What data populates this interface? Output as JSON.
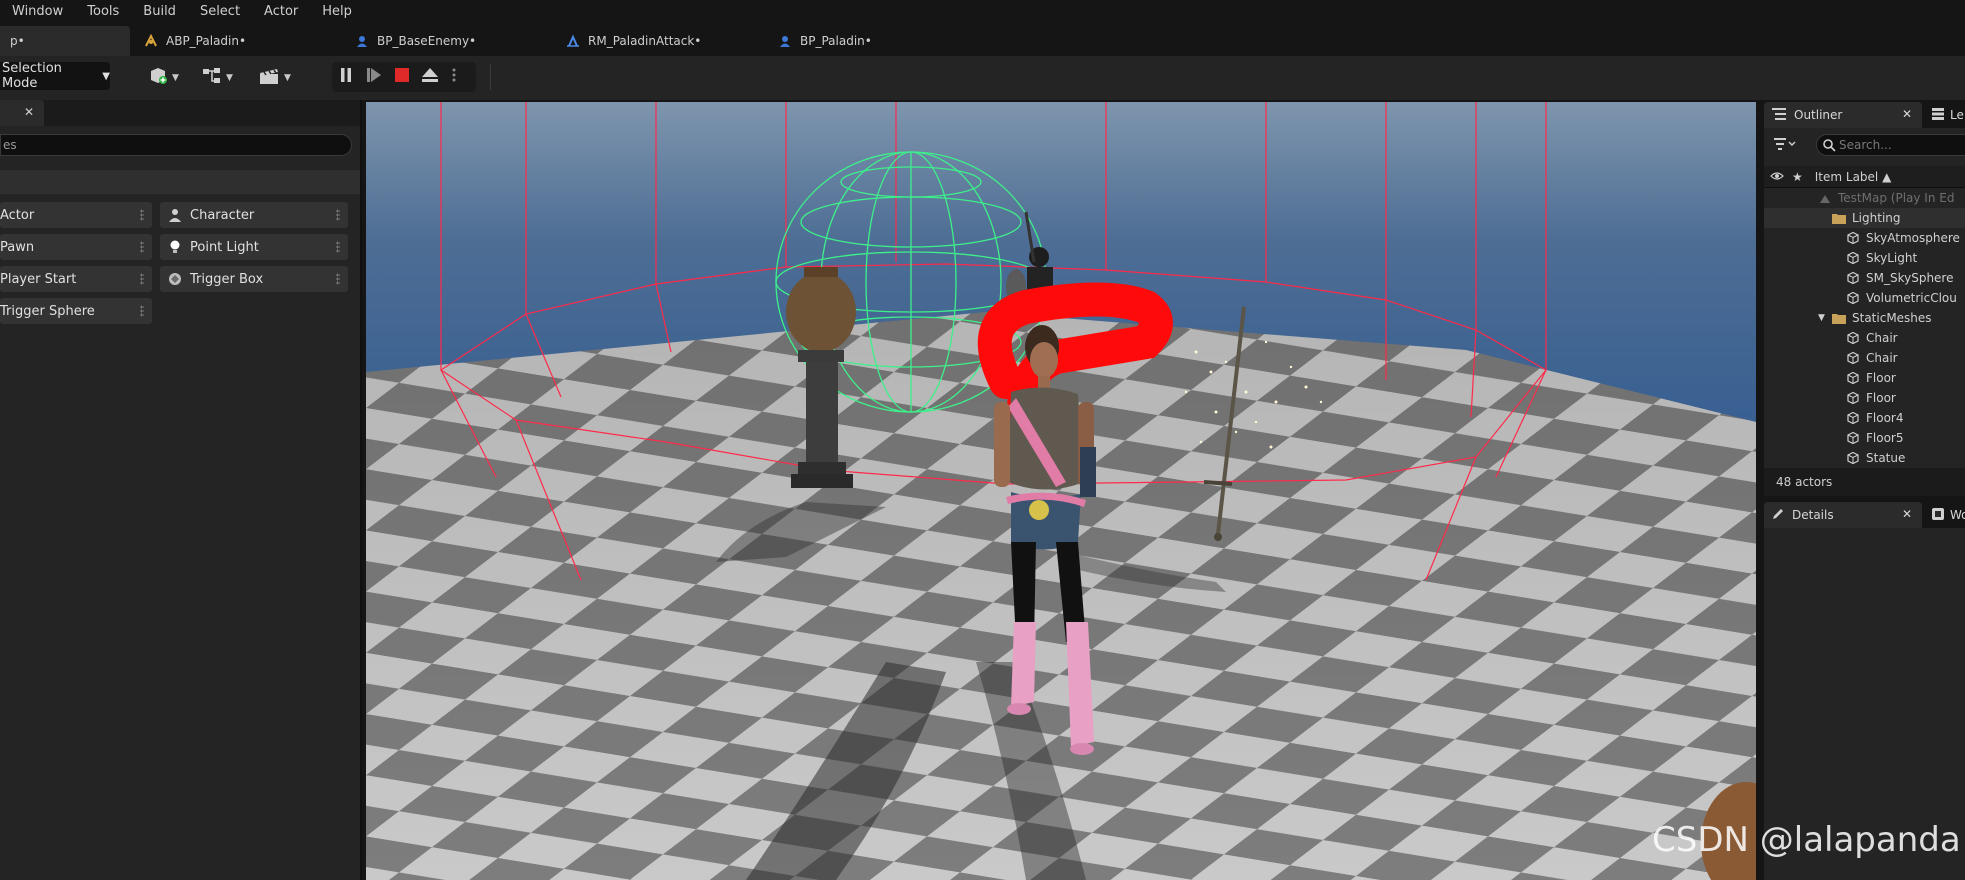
{
  "menu": [
    "Window",
    "Tools",
    "Build",
    "Select",
    "Actor",
    "Help"
  ],
  "tabs": [
    {
      "label": "p•",
      "active": true
    },
    {
      "label": "ABP_Paladin•"
    },
    {
      "label": "BP_BaseEnemy•"
    },
    {
      "label": "RM_PaladinAttack•"
    },
    {
      "label": "BP_Paladin•"
    }
  ],
  "toolbar": {
    "selection_mode": "Selection Mode"
  },
  "place_actors": {
    "search_placeholder": "es",
    "items": [
      "Actor",
      "Character",
      "Pawn",
      "Point Light",
      "Player Start",
      "Trigger Box",
      "Trigger Sphere"
    ]
  },
  "outliner": {
    "tab_label": "Outliner",
    "levels_tab_label": "Le",
    "search_placeholder": "Search...",
    "column_label": "Item Label ▲",
    "rows": [
      {
        "label": "TestMap (Play In Ed",
        "indent": 1,
        "dim": true
      },
      {
        "label": "Lighting",
        "indent": 2,
        "folder": true,
        "selected": true
      },
      {
        "label": "SkyAtmosphere",
        "indent": 3
      },
      {
        "label": "SkyLight",
        "indent": 3
      },
      {
        "label": "SM_SkySphere",
        "indent": 3
      },
      {
        "label": "VolumetricClou",
        "indent": 3
      },
      {
        "label": "StaticMeshes",
        "indent": 2,
        "folder": true
      },
      {
        "label": "Chair",
        "indent": 3
      },
      {
        "label": "Chair",
        "indent": 3
      },
      {
        "label": "Floor",
        "indent": 3
      },
      {
        "label": "Floor",
        "indent": 3
      },
      {
        "label": "Floor4",
        "indent": 3
      },
      {
        "label": "Floor5",
        "indent": 3
      },
      {
        "label": "Statue",
        "indent": 3
      }
    ],
    "footer": "48 actors"
  },
  "details": {
    "tab_label": "Details",
    "world_tab_label": "Wo"
  },
  "watermark": "CSDN @lalapanda"
}
